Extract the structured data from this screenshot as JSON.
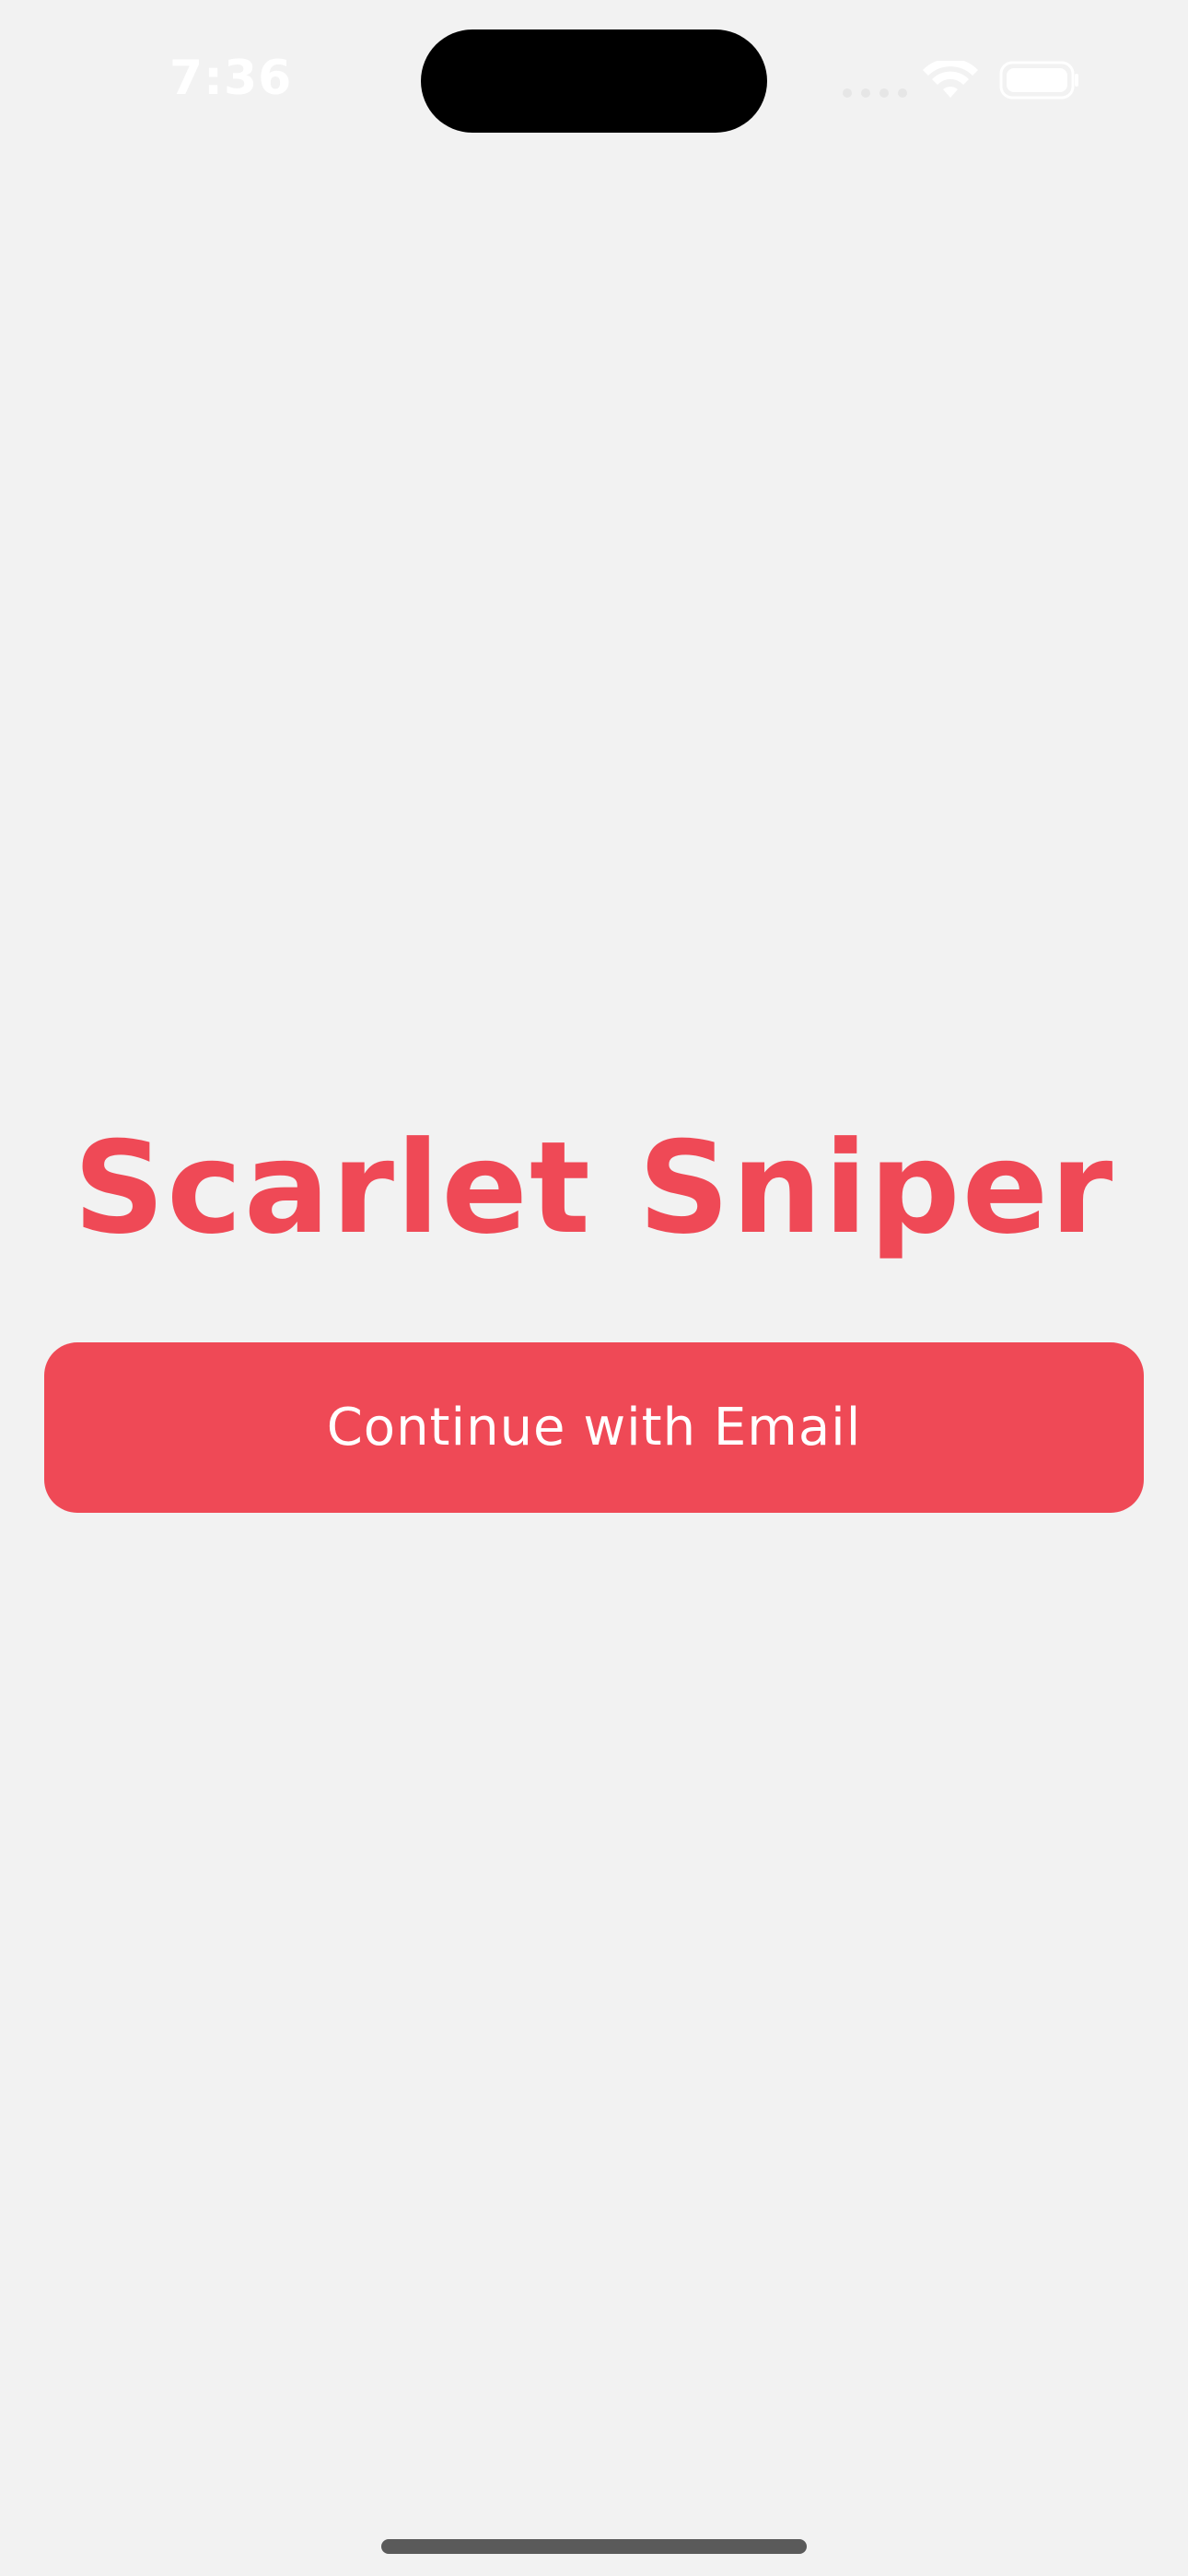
{
  "status_bar": {
    "time": "7:36",
    "icons": [
      "signal-icon",
      "wifi-icon",
      "battery-icon"
    ]
  },
  "app": {
    "title": "Scarlet Sniper",
    "continue_button_label": "Continue with Email"
  },
  "colors": {
    "accent": "#ef4956",
    "background": "#f2f2f2",
    "button_text": "#ffffff"
  }
}
